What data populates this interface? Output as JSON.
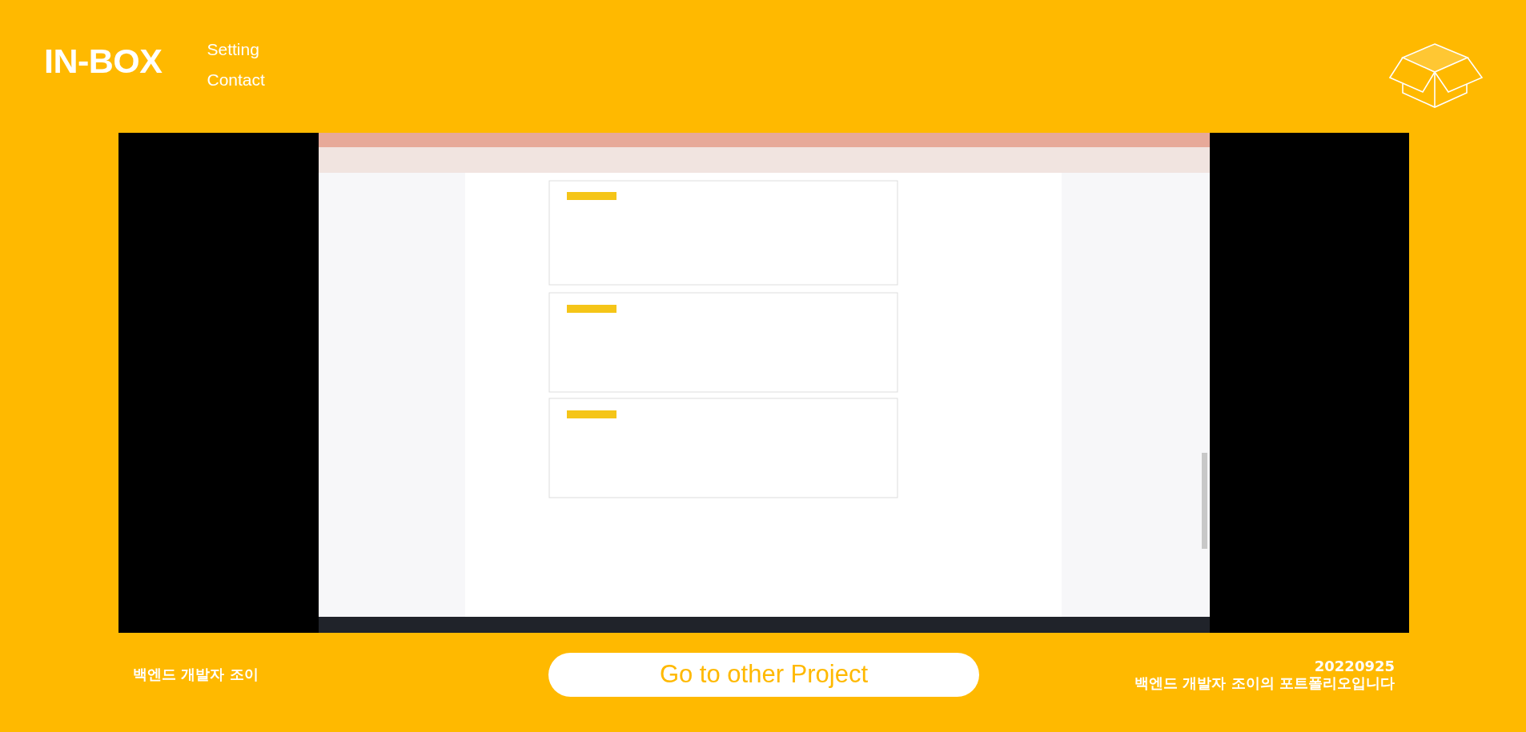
{
  "header": {
    "logo": "IN-BOX",
    "nav": [
      {
        "label": "Setting"
      },
      {
        "label": "Contact"
      }
    ]
  },
  "footer": {
    "author": "백엔드 개발자 조이",
    "button": "Go to other Project",
    "info": [
      "20220925",
      "백엔드 개발자 조이의 포트폴리오입니다"
    ]
  }
}
